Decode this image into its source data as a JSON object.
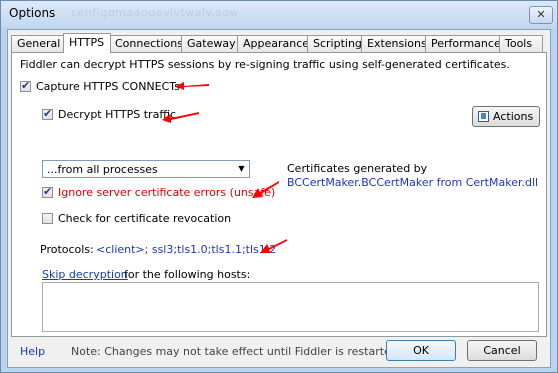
{
  "window": {
    "title": "Options",
    "title_ghost": "cenfigqmaaouevivtwaly.aow",
    "close_glyph": "✕"
  },
  "tabs": [
    {
      "label": "General"
    },
    {
      "label": "HTTPS",
      "active": true
    },
    {
      "label": "Connections"
    },
    {
      "label": "Gateway"
    },
    {
      "label": "Appearance"
    },
    {
      "label": "Scripting"
    },
    {
      "label": "Extensions"
    },
    {
      "label": "Performance"
    },
    {
      "label": "Tools"
    }
  ],
  "https": {
    "intro": "Fiddler can decrypt HTTPS sessions by re-signing traffic using self-generated certificates.",
    "capture_connects": {
      "label": "Capture HTTPS CONNECTs",
      "checked": true
    },
    "decrypt_traffic": {
      "label": "Decrypt HTTPS traffic",
      "checked": true
    },
    "process_filter": {
      "value": "...from all processes"
    },
    "ignore_cert_errors": {
      "label": "Ignore server certificate errors (unsafe)",
      "checked": true
    },
    "check_revocation": {
      "label": "Check for certificate revocation",
      "checked": false
    },
    "cert_info_line1": "Certificates generated by",
    "cert_info_line2": "BCCertMaker.BCCertMaker from CertMaker.dll",
    "actions_button": "Actions",
    "protocols_label": "Protocols:",
    "protocols_value": "<client>; ssl3;tls1.0;tls1.1;tls1.2",
    "skip_link": "Skip decryption",
    "skip_suffix": "for the following hosts:",
    "hosts_value": ""
  },
  "footer": {
    "help": "Help",
    "note": "Note: Changes may not take effect until Fiddler is restarted.",
    "ok": "OK",
    "cancel": "Cancel"
  },
  "colors": {
    "link": "#1a37b8",
    "warning": "#e00000",
    "annotation_arrow": "#ff0000"
  },
  "icons": [
    "close-icon",
    "checkmark-icon",
    "dropdown-arrow-icon",
    "actions-icon",
    "red-arrow-annotation-icon"
  ]
}
